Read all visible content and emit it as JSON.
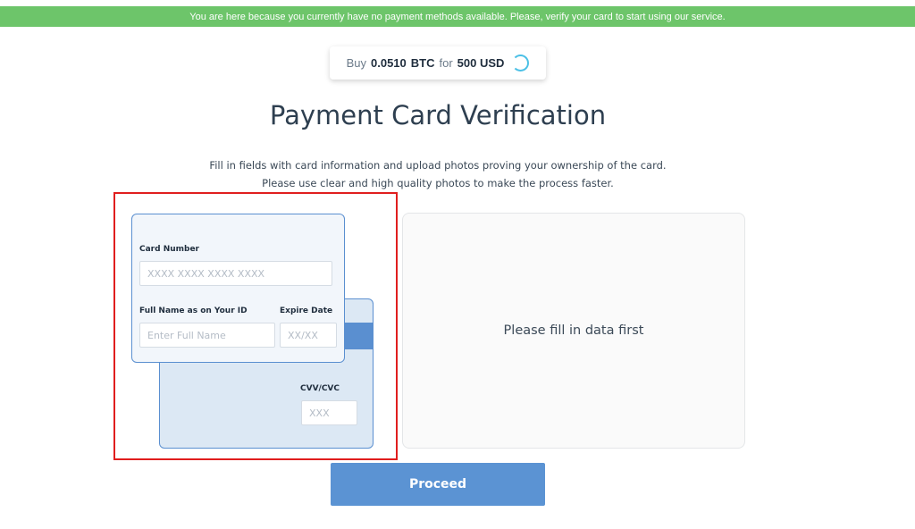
{
  "banner": {
    "text": "You are here because you currently have no payment methods available. Please, verify your card to start using our service."
  },
  "price": {
    "buy_label": "Buy",
    "amount": "0.0510",
    "currency": "BTC",
    "for_label": "for",
    "fiat": "500 USD"
  },
  "header": {
    "title": "Payment Card Verification",
    "subtitle_line1": "Fill in fields with card information and upload photos proving your ownership of the card.",
    "subtitle_line2": "Please use clear and high quality photos to make the process faster."
  },
  "card_form": {
    "card_number_label": "Card Number",
    "card_number_placeholder": "XXXX XXXX XXXX XXXX",
    "full_name_label": "Full Name as on Your ID",
    "full_name_placeholder": "Enter Full Name",
    "expire_label": "Expire Date",
    "expire_placeholder": "XX/XX",
    "cvv_label": "CVV/CVC",
    "cvv_placeholder": "XXX"
  },
  "preview": {
    "message": "Please fill in data first"
  },
  "actions": {
    "proceed_label": "Proceed"
  },
  "colors": {
    "banner": "#6dc56a",
    "accent": "#5b93d3",
    "card_border": "#5a8fd0",
    "highlight": "#e01e1e",
    "spinner": "#4cc0e6"
  },
  "icons": {
    "loading": "loading-spinner-icon"
  }
}
